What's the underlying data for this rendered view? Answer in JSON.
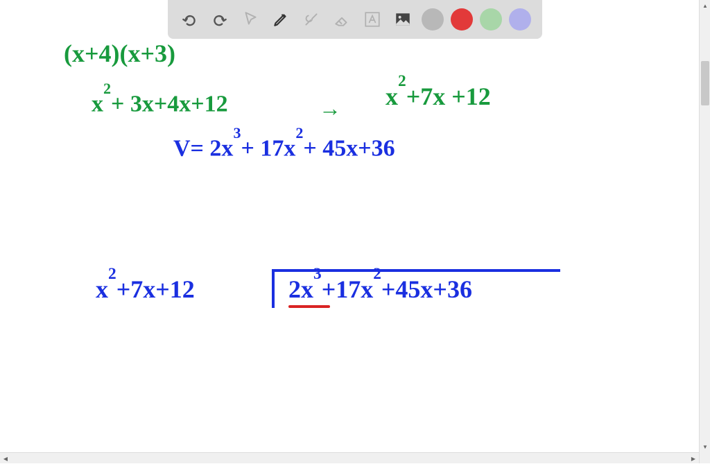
{
  "toolbar": {
    "icons": {
      "undo": "undo-icon",
      "redo": "redo-icon",
      "cursor": "cursor-icon",
      "pen": "pen-icon",
      "tools": "tools-icon",
      "eraser": "eraser-icon",
      "text": "text-icon",
      "image": "image-icon"
    },
    "colors": {
      "gray": "#b8b8b8",
      "red": "#e23a3a",
      "green": "#a8d6a8",
      "purple": "#b0b0ec"
    }
  },
  "math": {
    "line1": "(x+4)(x+3)",
    "line2a": "x²+3x+4x+12",
    "line2arrow": "→",
    "line2b": "x²+7x+12",
    "line3": "V= 2x³+17x²+45x+36",
    "line4divisor": "x²+7x+12",
    "line4dividend": "2x³+17x²+45x+36"
  }
}
